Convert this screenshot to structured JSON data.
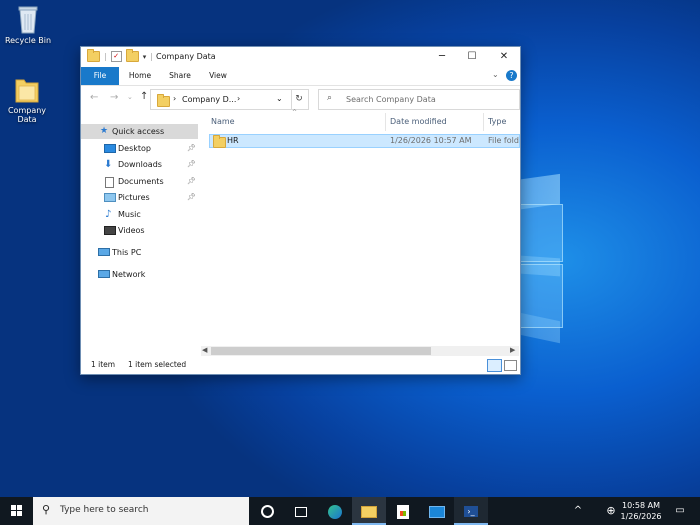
{
  "desktop": {
    "icons": [
      {
        "label": "Recycle Bin"
      },
      {
        "label": "Company Data"
      }
    ]
  },
  "window": {
    "title": "Company Data",
    "ribbon_tabs": [
      "File",
      "Home",
      "Share",
      "View"
    ],
    "address": "Company D...",
    "search_placeholder": "Search Company Data",
    "nav": {
      "quick_access": "Quick access",
      "pinned": [
        "Desktop",
        "Downloads",
        "Documents",
        "Pictures"
      ],
      "unpinned": [
        "Music",
        "Videos"
      ],
      "this_pc": "This PC",
      "network": "Network"
    },
    "columns": {
      "name": "Name",
      "date": "Date modified",
      "type": "Type"
    },
    "rows": [
      {
        "name": "HR",
        "date": "1/26/2026 10:57 AM",
        "type": "File folder"
      }
    ],
    "status": {
      "count": "1 item",
      "selected": "1 item selected"
    }
  },
  "taskbar": {
    "search_text": "Type here to search",
    "time": "10:58 AM",
    "date": "1/26/2026"
  },
  "colors": {
    "accent": "#1979ca",
    "selection": "#cce8ff",
    "taskbar": "#101820"
  }
}
